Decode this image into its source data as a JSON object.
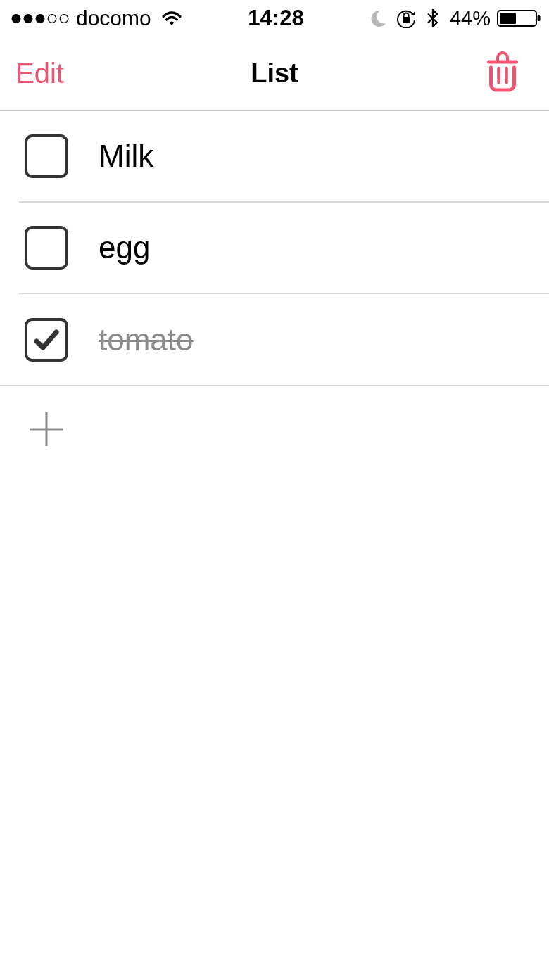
{
  "status_bar": {
    "carrier": "docomo",
    "time": "14:28",
    "battery": "44%"
  },
  "nav_bar": {
    "edit": "Edit",
    "title": "List"
  },
  "items": [
    {
      "text": "Milk",
      "checked": false
    },
    {
      "text": "egg",
      "checked": false
    },
    {
      "text": "tomato",
      "checked": true
    }
  ]
}
